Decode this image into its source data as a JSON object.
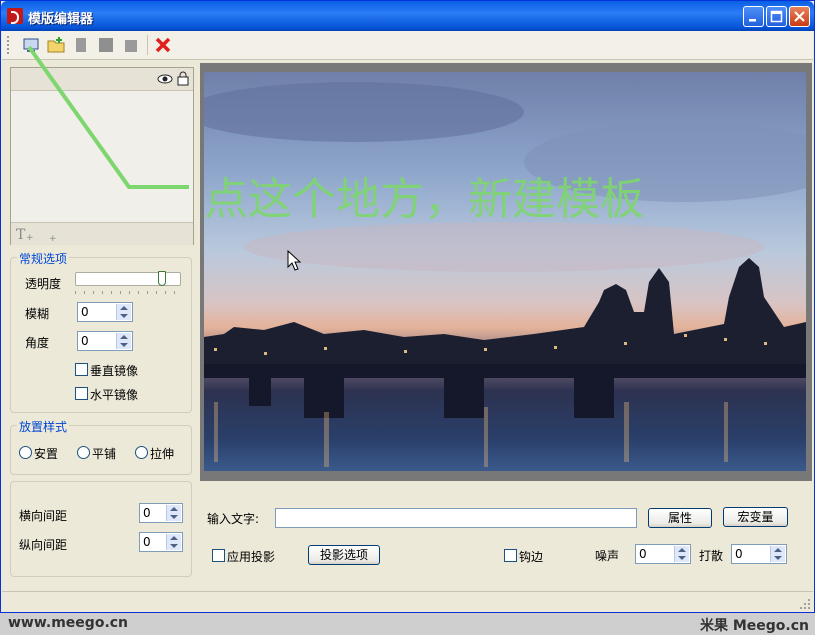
{
  "window": {
    "title": "模版编辑器"
  },
  "toolbar": {
    "icons": [
      "new-template-icon",
      "open-folder-icon",
      "copy-icon",
      "save-icon",
      "paste-icon",
      "delete-icon"
    ]
  },
  "annotation": {
    "hint": "点这个地方，新建模板"
  },
  "left": {
    "general": {
      "title": "常规选项",
      "opacity_label": "透明度",
      "opacity_level": 0.85,
      "blur_label": "模糊",
      "blur_value": "0",
      "angle_label": "角度",
      "angle_value": "0",
      "vflip_label": "垂直镜像",
      "hflip_label": "水平镜像"
    },
    "placement": {
      "title": "放置样式",
      "opt1": "安置",
      "opt2": "平铺",
      "opt3": "拉伸"
    },
    "spacing": {
      "h_label": "横向间距",
      "h_value": "0",
      "v_label": "纵向间距",
      "v_value": "0"
    }
  },
  "bottom": {
    "input_label": "输入文字:",
    "input_value": "",
    "props_button": "属性",
    "macro_button": "宏变量",
    "shadow_label": "应用投影",
    "shadow_options_button": "投影选项",
    "hook_label": "钩边",
    "noise_label": "噪声",
    "noise_value": "0",
    "scatter_label": "打散",
    "scatter_value": "0"
  },
  "footer": {
    "left": "www.meego.cn",
    "right": "米果 Meego.cn"
  },
  "colors": {
    "title_blue": "#0a5fe4",
    "group_title": "#0046d5",
    "hint_green": "#7ed66f"
  }
}
